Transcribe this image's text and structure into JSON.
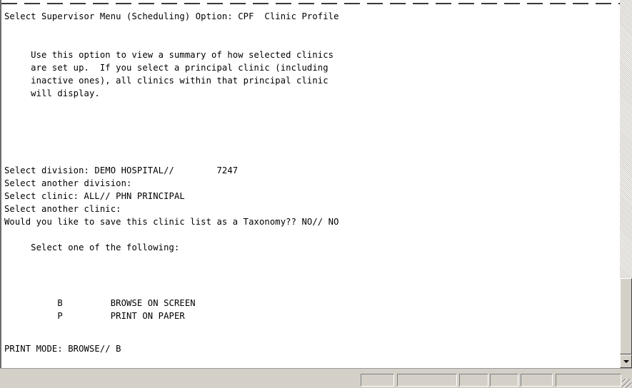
{
  "terminal": {
    "lines": [
      "Select Supervisor Menu (Scheduling) Option: CPF  Clinic Profile",
      "",
      "",
      "     Use this option to view a summary of how selected clinics",
      "     are set up.  If you select a principal clinic (including",
      "     inactive ones), all clinics within that principal clinic",
      "     will display.",
      "",
      "",
      "Select division: DEMO HOSPITAL//        7247",
      "Select another division:",
      "Select clinic: ALL// PHN PRINCIPAL",
      "Select another clinic:",
      "Would you like to save this clinic list as a Taxonomy?? NO// NO",
      "",
      "     Select one of the following:",
      "",
      "          B         BROWSE ON SCREEN",
      "          P         PRINT ON PAPER",
      "",
      "PRINT MODE: BROWSE// B"
    ]
  },
  "icons": {
    "scroll_down": "chevron-down-icon",
    "resize": "resize-grip-icon"
  },
  "colors": {
    "background": "#ffffff",
    "text": "#000000",
    "chrome": "#d4d0c8"
  }
}
